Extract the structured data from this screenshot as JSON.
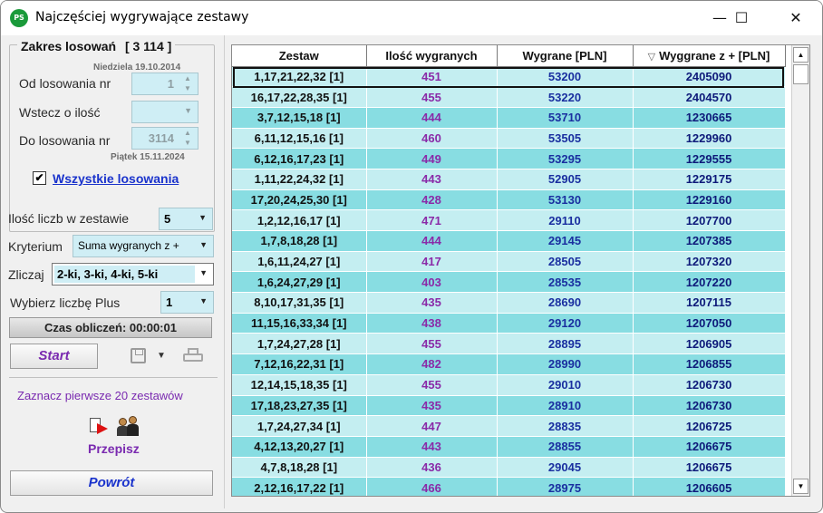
{
  "window": {
    "title": "Najczęściej wygrywające zestawy",
    "icon_text": "PS",
    "minimize_icon": "minimize-icon",
    "maximize_icon": "maximize-icon",
    "close_icon": "close-icon"
  },
  "range": {
    "title": "Zakres losowań",
    "count": "[ 3 114 ]",
    "from_date": "Niedziela 19.10.2014",
    "from_label": "Od losowania nr",
    "from_value": "1",
    "back_label": "Wstecz o ilość",
    "back_value": "",
    "to_label": "Do losowania nr",
    "to_value": "3114",
    "to_date": "Piątek 15.11.2024",
    "all_checked": "✔",
    "all_label": "Wszystkie losowania"
  },
  "options": {
    "count_label": "Ilość liczb w zestawie",
    "count_value": "5",
    "criterion_label": "Kryterium",
    "criterion_value": "Suma wygranych z +",
    "count_hits_label": "Zliczaj",
    "count_hits_value": "2-ki, 3-ki, 4-ki, 5-ki",
    "plus_label": "Wybierz liczbę Plus",
    "plus_value": "1"
  },
  "actions": {
    "calc_time": "Czas obliczeń: 00:00:01",
    "start": "Start",
    "mark_first": "Zaznacz pierwsze 20 zestawów",
    "copy": "Przepisz",
    "back": "Powrót"
  },
  "table": {
    "headers": [
      "Zestaw",
      "Ilość wygranych",
      "Wygrane [PLN]",
      "Wyggrane z + [PLN]"
    ],
    "sort_mark": "▽",
    "rows": [
      [
        "1,17,21,22,32 [1]",
        "451",
        "53200",
        "2405090"
      ],
      [
        "16,17,22,28,35 [1]",
        "455",
        "53220",
        "2404570"
      ],
      [
        "3,7,12,15,18 [1]",
        "444",
        "53710",
        "1230665"
      ],
      [
        "6,11,12,15,16 [1]",
        "460",
        "53505",
        "1229960"
      ],
      [
        "6,12,16,17,23 [1]",
        "449",
        "53295",
        "1229555"
      ],
      [
        "1,11,22,24,32 [1]",
        "443",
        "52905",
        "1229175"
      ],
      [
        "17,20,24,25,30 [1]",
        "428",
        "53130",
        "1229160"
      ],
      [
        "1,2,12,16,17 [1]",
        "471",
        "29110",
        "1207700"
      ],
      [
        "1,7,8,18,28 [1]",
        "444",
        "29145",
        "1207385"
      ],
      [
        "1,6,11,24,27 [1]",
        "417",
        "28505",
        "1207320"
      ],
      [
        "1,6,24,27,29 [1]",
        "403",
        "28535",
        "1207220"
      ],
      [
        "8,10,17,31,35 [1]",
        "435",
        "28690",
        "1207115"
      ],
      [
        "11,15,16,33,34 [1]",
        "438",
        "29120",
        "1207050"
      ],
      [
        "1,7,24,27,28 [1]",
        "455",
        "28895",
        "1206905"
      ],
      [
        "7,12,16,22,31 [1]",
        "482",
        "28990",
        "1206855"
      ],
      [
        "12,14,15,18,35 [1]",
        "455",
        "29010",
        "1206730"
      ],
      [
        "17,18,23,27,35 [1]",
        "435",
        "28910",
        "1206730"
      ],
      [
        "1,7,24,27,34 [1]",
        "447",
        "28835",
        "1206725"
      ],
      [
        "4,12,13,20,27 [1]",
        "443",
        "28855",
        "1206675"
      ],
      [
        "4,7,8,18,28 [1]",
        "436",
        "29045",
        "1206675"
      ],
      [
        "2,12,16,17,22 [1]",
        "466",
        "28975",
        "1206605"
      ]
    ]
  }
}
